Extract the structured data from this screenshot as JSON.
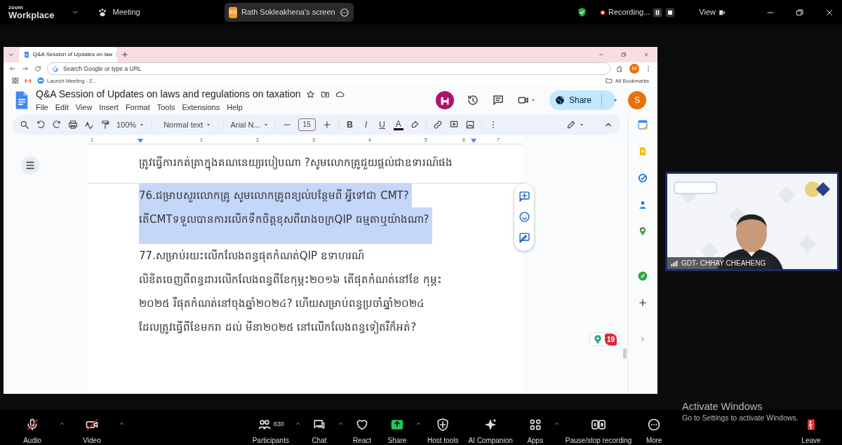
{
  "top_bar": {
    "logo": "zoom",
    "product": "Workplace",
    "meeting": "Meeting",
    "share_tag": {
      "initials": "RS",
      "label": "Rath Sokleakhena's screen"
    },
    "recording": "Recording...",
    "view": "View"
  },
  "browser": {
    "tab": "Q&A Session of Updates on law",
    "address_placeholder": "Search Google or type a URL",
    "profile": "M",
    "bookmarks": [
      "Launch Meeting - Z..."
    ],
    "all_bookmarks": "All Bookmarks"
  },
  "doc": {
    "title": "Q&A Session of Updates on laws and regulations on taxation",
    "menu": [
      "File",
      "Edit",
      "View",
      "Insert",
      "Format",
      "Tools",
      "Extensions",
      "Help"
    ],
    "share": "Share",
    "avatar": "S",
    "toolbar": {
      "zoom": "100%",
      "style": "Normal text",
      "font": "Arial N...",
      "size": "15",
      "format": [
        {
          "label": "B",
          "kind": "bold"
        },
        {
          "label": "I",
          "kind": "italic"
        },
        {
          "label": "U",
          "kind": "underline"
        },
        {
          "label": "A",
          "kind": "color"
        }
      ]
    },
    "ruler": [
      "1",
      "1",
      "2",
      "3",
      "4",
      "5",
      "6",
      "7"
    ],
    "previous_page_lines": [
      {
        "text": "ត្រូវធ្វើការកត់ត្រាក្នុងគណនេយ្យរបៀបណា ?សូមលោកគ្រូជួយផ្តល់ជាឧទារណ៍ផង",
        "selected": false
      }
    ],
    "lines": [
      {
        "text": "76.ជម្រាបសួរលោកគ្រូ សូមលោកគ្រូពន្យល់បន្ថែមពី អ្វីទៅជា CMT?",
        "selected": true
      },
      {
        "text": "តើCMTទទួលបានការលើកទឹកចិត្តខុសពីរោងចក្រQIP ធម្មតាឬយ៉ាងណា?",
        "selected": true
      },
      {
        "text": "77.សម្រាប់រយះលើកលែងពន្ធផុតកំណត់QIP ឧទាហរណ៍",
        "selected": false
      },
      {
        "text": "លិខិតចេញពីពន្ធដារលើកលែងពន្ធពីខែកុម្ភះ២០១៦ តើផុតកំណត់នៅខែ កុម្ភះ",
        "selected": false
      },
      {
        "text": "២០២៥ រឺផុតកំណត់នៅចុងឆ្នាំ២០២៤? ហើយសម្រាប់ពន្ធប្រចាំឆ្នាំ២០២៤",
        "selected": false
      },
      {
        "text": "ដែលត្រូវធ្វើពីខែមករា ដល់ មីនា២០២៥ នៅលើកលែងពន្ធទៀតរឺក៏អត់?",
        "selected": false
      }
    ],
    "badge": "19"
  },
  "speaker": {
    "name": "GDT- CHHAY CHEAHENG"
  },
  "controls_left": [
    {
      "label": "Audio",
      "kind": "audio",
      "muted": true,
      "caret": true
    },
    {
      "label": "Video",
      "kind": "video",
      "muted": true,
      "caret": true
    }
  ],
  "controls_center": [
    {
      "label": "Participants",
      "kind": "participants",
      "count": "830",
      "caret": true
    },
    {
      "label": "Chat",
      "kind": "chat",
      "caret": true
    },
    {
      "label": "React",
      "kind": "react",
      "caret": false
    },
    {
      "label": "Share",
      "kind": "share",
      "caret": true
    },
    {
      "label": "Host tools",
      "kind": "host",
      "caret": false
    },
    {
      "label": "AI Companion",
      "kind": "ai",
      "caret": false
    },
    {
      "label": "Apps",
      "kind": "apps",
      "caret": true
    },
    {
      "label": "Pause/stop recording",
      "kind": "record",
      "caret": false
    },
    {
      "label": "More",
      "kind": "more",
      "caret": false
    }
  ],
  "controls_right": [
    {
      "label": "Leave",
      "kind": "leave",
      "caret": false
    }
  ],
  "activation_notice": {
    "title": "Activate Windows",
    "subtitle": "Go to Settings to activate Windows."
  }
}
